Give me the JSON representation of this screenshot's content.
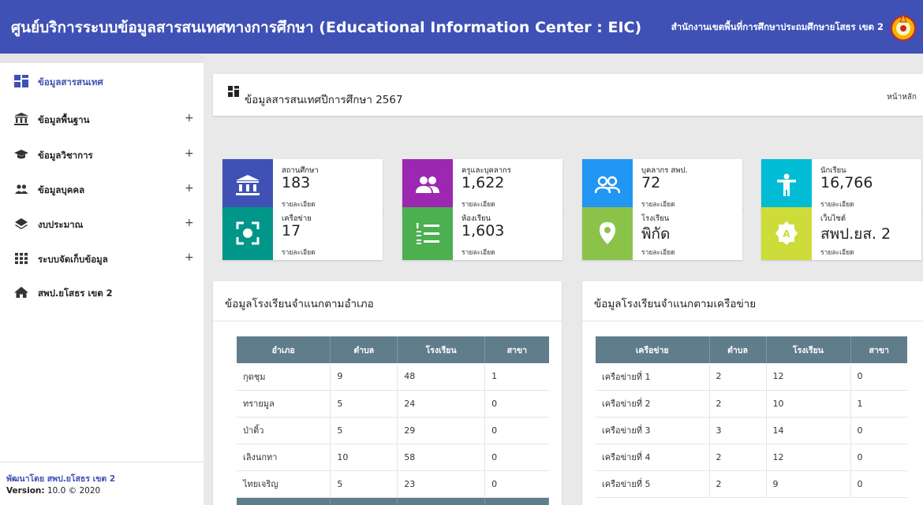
{
  "header": {
    "title": "ศูนย์บริการระบบข้อมูลสารสนเทศทางการศึกษา (Educational Information Center : EIC)",
    "org": "สำนักงานเขตพื้นที่การศึกษาประถมศึกษายโสธร เขต 2",
    "background": "#3f51b5"
  },
  "sidebar": {
    "items": [
      {
        "label": "ข้อมูลสารสนเทศ",
        "icon": "dashboard-icon",
        "has_submenu": false,
        "active": true
      },
      {
        "label": "ข้อมูลพื้นฐาน",
        "icon": "bank-icon",
        "has_submenu": true
      },
      {
        "label": "ข้อมูลวิชาการ",
        "icon": "graduation-cap-icon",
        "has_submenu": true
      },
      {
        "label": "ข้อมูลบุคคล",
        "icon": "people-icon",
        "has_submenu": true
      },
      {
        "label": "งบประมาณ",
        "icon": "layers-icon",
        "has_submenu": true
      },
      {
        "label": "ระบบจัดเก็บข้อมูล",
        "icon": "grid-icon",
        "has_submenu": true
      },
      {
        "label": "สพป.ยโสธร เขต 2",
        "icon": "home-icon",
        "has_submenu": false
      }
    ],
    "plus": "+",
    "footer": {
      "developer": "พัฒนาโดย สพป.ยโสธร เขต 2",
      "version_label": "Version:",
      "version": "10.0 © 2020"
    }
  },
  "panel": {
    "title": "ข้อมูลสารสนเทศปีการศึกษา 2567",
    "breadcrumb": "หน้าหลัก"
  },
  "info_boxes": [
    {
      "caption": "สถานศึกษา",
      "value": "183",
      "link": "รายละเอียด",
      "icon": "bank-icon",
      "color": "#3f51b5"
    },
    {
      "caption": "ครูและบุคลากร",
      "value": "1,622",
      "link": "รายละเอียด",
      "icon": "group-icon",
      "color": "#9c27b0"
    },
    {
      "caption": "บุคลากร สพป.",
      "value": "72",
      "link": "รายละเอียด",
      "icon": "people-outline-icon",
      "color": "#2196f3"
    },
    {
      "caption": "นักเรียน",
      "value": "16,766",
      "link": "รายละเอียด",
      "icon": "person-icon",
      "color": "#00bcd4"
    },
    {
      "caption": "เครือข่าย",
      "value": "17",
      "link": "รายละเอียด",
      "icon": "focus-icon",
      "color": "#009688"
    },
    {
      "caption": "ห้องเรียน",
      "value": "1,603",
      "link": "รายละเอียด",
      "icon": "numbered-list-icon",
      "color": "#4caf50"
    },
    {
      "caption": "โรงเรียน",
      "value": "พิกัด",
      "link": "รายละเอียด",
      "icon": "map-pin-icon",
      "color": "#8bc34a"
    },
    {
      "caption": "เว็บไซต์",
      "value": "สพป.ยส. 2",
      "link": "รายละเอียด",
      "icon": "badge-icon",
      "color": "#cddc39"
    }
  ],
  "district_card": {
    "title": "ข้อมูลโรงเรียนจำแนกตามอำเภอ",
    "headers": [
      "อำเภอ",
      "ตำบล",
      "โรงเรียน",
      "สาขา"
    ],
    "rows": [
      [
        "กุดชุม",
        "9",
        "48",
        "1"
      ],
      [
        "ทรายมูล",
        "5",
        "24",
        "0"
      ],
      [
        "ป่าติ้ว",
        "5",
        "29",
        "0"
      ],
      [
        "เลิงนกทา",
        "10",
        "58",
        "0"
      ],
      [
        "ไทยเจริญ",
        "5",
        "23",
        "0"
      ]
    ]
  },
  "network_card": {
    "title": "ข้อมูลโรงเรียนจำแนกตามเครือข่าย",
    "headers": [
      "เครือข่าย",
      "ตำบล",
      "โรงเรียน",
      "สาขา"
    ],
    "rows": [
      [
        "เครือข่ายที่ 1",
        "2",
        "12",
        "0"
      ],
      [
        "เครือข่ายที่ 2",
        "2",
        "10",
        "1"
      ],
      [
        "เครือข่ายที่ 3",
        "3",
        "14",
        "0"
      ],
      [
        "เครือข่ายที่ 4",
        "2",
        "12",
        "0"
      ],
      [
        "เครือข่ายที่ 5",
        "2",
        "9",
        "0"
      ]
    ]
  }
}
